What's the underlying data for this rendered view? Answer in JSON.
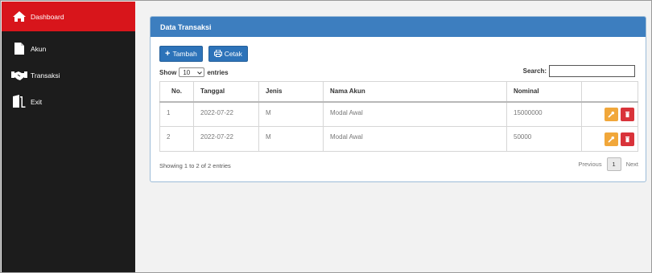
{
  "sidebar": {
    "items": [
      {
        "label": "Dashboard",
        "icon": "home-icon",
        "active": true
      },
      {
        "label": "Akun",
        "icon": "file-icon"
      },
      {
        "label": "Transaksi",
        "icon": "handshake-icon"
      },
      {
        "label": "Exit",
        "icon": "door-exit-icon"
      }
    ],
    "active_color": "#d8151b"
  },
  "panel": {
    "title": "Data Transaksi",
    "tambah_label": "Tambah",
    "cetak_label": "Cetak",
    "show_label": "Show",
    "show_value": "10",
    "entries_label": "entries",
    "search_label": "Search:",
    "search_value": ""
  },
  "table": {
    "headers": [
      "No.",
      "Tanggal",
      "Jenis",
      "Nama Akun",
      "Nominal",
      ""
    ],
    "rows": [
      {
        "no": "1",
        "tanggal": "2022-07-22",
        "jenis": "M",
        "nama_akun": "Modal Awal",
        "nominal": "15000000"
      },
      {
        "no": "2",
        "tanggal": "2022-07-22",
        "jenis": "M",
        "nama_akun": "Modal Awal",
        "nominal": "50000"
      }
    ]
  },
  "footer": {
    "info": "Showing 1 to 2 of 2 entries",
    "previous": "Previous",
    "page": "1",
    "next": "Next"
  },
  "colors": {
    "primary": "#2d73b9",
    "header": "#3d7ebf",
    "edit": "#f1a73a",
    "delete": "#d9333a"
  }
}
